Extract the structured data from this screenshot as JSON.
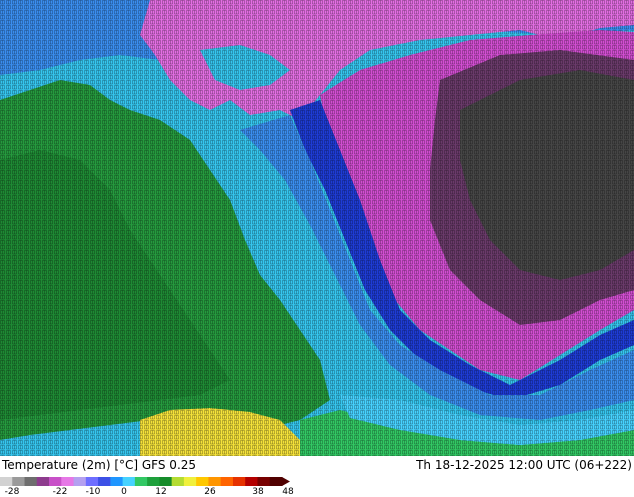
{
  "map": {
    "title": "Temperature (2m) [°C] GFS 0.25",
    "timestamp": "Th 18-12-2025 12:00 UTC (06+222)"
  },
  "legend": {
    "ticks": [
      "-28",
      "-22",
      "-10",
      "0",
      "12",
      "26",
      "38",
      "48"
    ],
    "colors": [
      "#d2d2d2",
      "#9a9a9a",
      "#6e6e6e",
      "#8e3c8e",
      "#c850c8",
      "#e678e6",
      "#b4a0f0",
      "#6e6eff",
      "#3c50e6",
      "#1e96ff",
      "#46d2ff",
      "#32c864",
      "#1ea03c",
      "#168c2a",
      "#b4dc32",
      "#f0f03c",
      "#ffc800",
      "#ff9600",
      "#ff6400",
      "#e63200",
      "#b40000",
      "#780000",
      "#500000"
    ]
  },
  "colors": {
    "deep_cold": "#464646",
    "very_cold": "#6a3a6a",
    "cold_purple": "#d24ed2",
    "magenta": "#e36ee3",
    "sea_cyan": "#35c6ef",
    "mid_blue": "#3a8ef0",
    "deep_blue": "#1e3cd6",
    "land_green": "#259a3e",
    "dark_green": "#1e8a34",
    "warm_yellow": "#f5e23a"
  }
}
